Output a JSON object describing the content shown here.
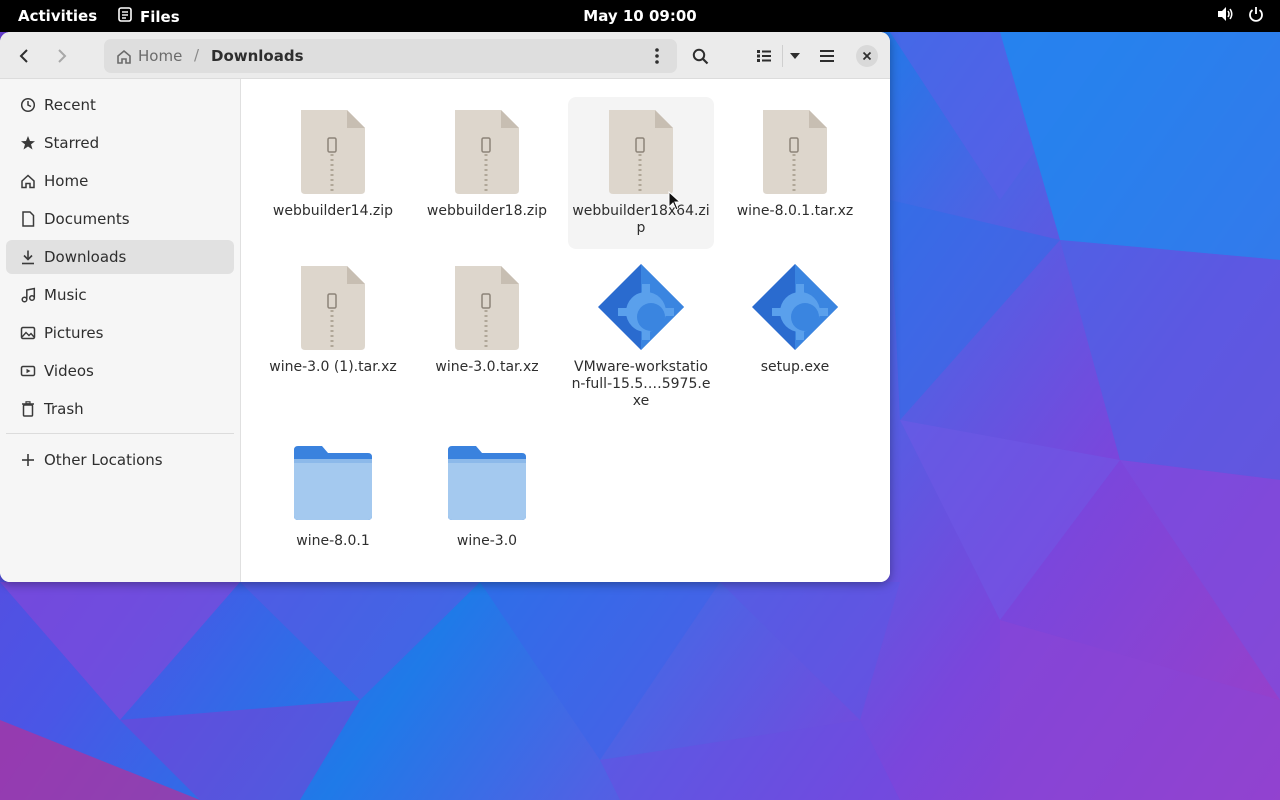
{
  "topbar": {
    "activities": "Activities",
    "app_name": "Files",
    "clock": "May 10  09:00"
  },
  "window": {
    "path": {
      "home_label": "Home",
      "separator": "/",
      "current": "Downloads"
    },
    "sidebar": {
      "items": [
        {
          "label": "Recent",
          "icon": "clock-icon"
        },
        {
          "label": "Starred",
          "icon": "star-icon"
        },
        {
          "label": "Home",
          "icon": "home-icon"
        },
        {
          "label": "Documents",
          "icon": "document-icon"
        },
        {
          "label": "Downloads",
          "icon": "download-icon",
          "active": true
        },
        {
          "label": "Music",
          "icon": "music-icon"
        },
        {
          "label": "Pictures",
          "icon": "picture-icon"
        },
        {
          "label": "Videos",
          "icon": "video-icon"
        },
        {
          "label": "Trash",
          "icon": "trash-icon"
        }
      ],
      "other_locations": "Other Locations"
    },
    "files": [
      {
        "name": "webbuilder14.zip",
        "type": "archive"
      },
      {
        "name": "webbuilder18.zip",
        "type": "archive"
      },
      {
        "name": "webbuilder18x64.zip",
        "type": "archive",
        "hover": true
      },
      {
        "name": "wine-8.0.1.tar.xz",
        "type": "archive"
      },
      {
        "name": "wine-3.0 (1).tar.xz",
        "type": "archive"
      },
      {
        "name": "wine-3.0.tar.xz",
        "type": "archive"
      },
      {
        "name": "VMware-workstation-full-15.5.…5975.exe",
        "type": "executable"
      },
      {
        "name": "setup.exe",
        "type": "executable"
      },
      {
        "name": "wine-8.0.1",
        "type": "folder"
      },
      {
        "name": "wine-3.0",
        "type": "folder"
      }
    ]
  }
}
